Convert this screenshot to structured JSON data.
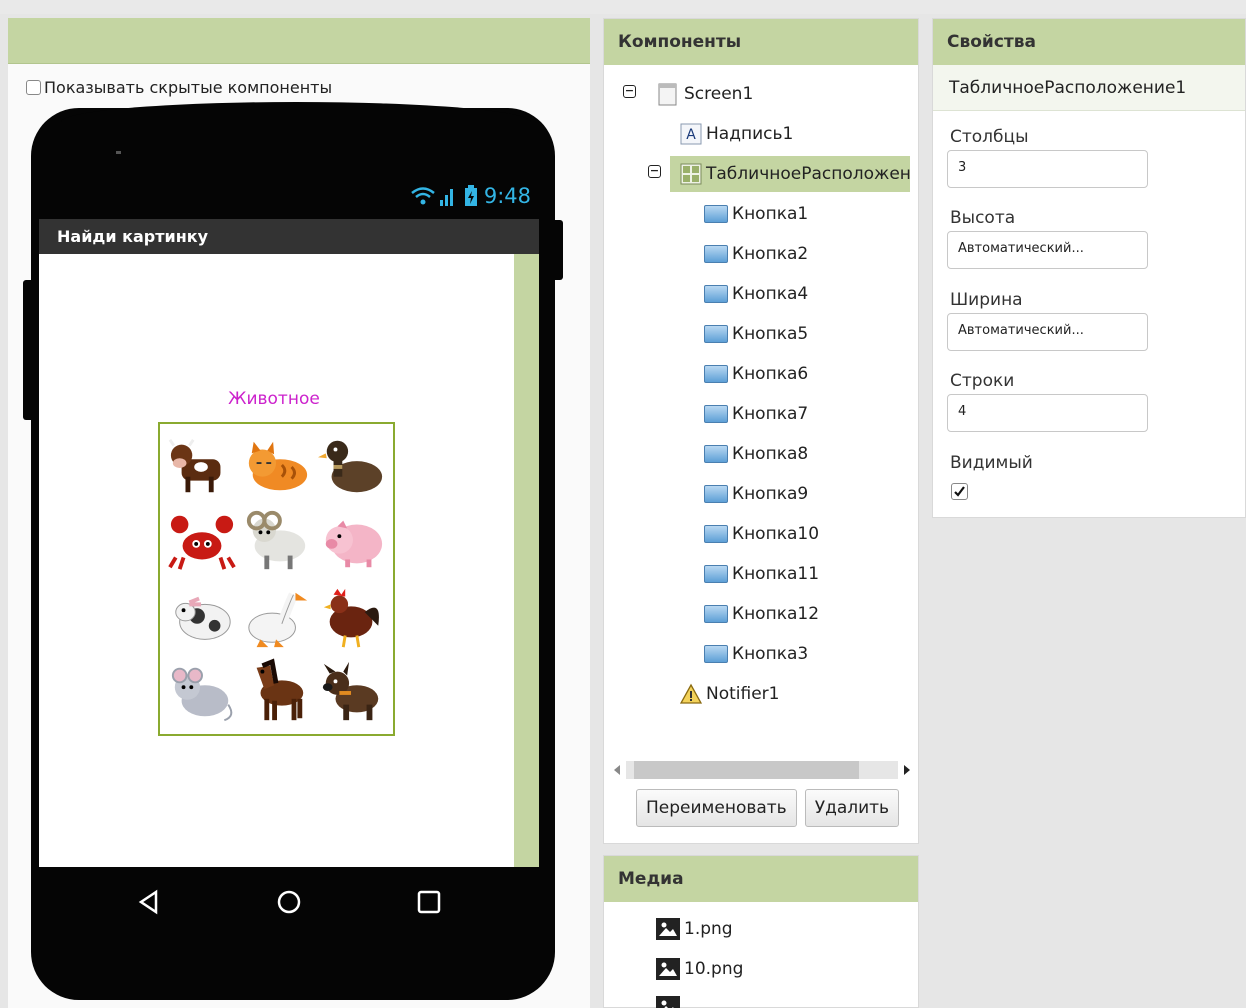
{
  "viewer": {
    "show_hidden_label": "Показывать скрытые компоненты",
    "status_time": "9:48",
    "app_title": "Найди картинку",
    "label_text": "Животное",
    "animals": [
      "cow",
      "cat",
      "duck",
      "crab",
      "ram",
      "pig",
      "goat",
      "goose",
      "rooster",
      "mouse",
      "horse",
      "dog"
    ]
  },
  "components": {
    "title": "Компоненты",
    "tree": [
      {
        "label": "Screen1",
        "icon": "screen-icon",
        "toggle": "⊟"
      },
      {
        "label": "Надпись1",
        "icon": "label-icon"
      },
      {
        "label": "ТабличноеРасположение1",
        "icon": "table-arrangement-icon",
        "toggle": "⊟",
        "selected": true
      },
      {
        "label": "Кнопка1",
        "icon": "button-icon"
      },
      {
        "label": "Кнопка2",
        "icon": "button-icon"
      },
      {
        "label": "Кнопка4",
        "icon": "button-icon"
      },
      {
        "label": "Кнопка5",
        "icon": "button-icon"
      },
      {
        "label": "Кнопка6",
        "icon": "button-icon"
      },
      {
        "label": "Кнопка7",
        "icon": "button-icon"
      },
      {
        "label": "Кнопка8",
        "icon": "button-icon"
      },
      {
        "label": "Кнопка9",
        "icon": "button-icon"
      },
      {
        "label": "Кнопка10",
        "icon": "button-icon"
      },
      {
        "label": "Кнопка11",
        "icon": "button-icon"
      },
      {
        "label": "Кнопка12",
        "icon": "button-icon"
      },
      {
        "label": "Кнопка3",
        "icon": "button-icon"
      },
      {
        "label": "Notifier1",
        "icon": "notifier-icon"
      }
    ],
    "rename_label": "Переименовать",
    "delete_label": "Удалить"
  },
  "media": {
    "title": "Медиа",
    "files": [
      "1.png",
      "10.png"
    ]
  },
  "properties": {
    "title": "Свойства",
    "component_name": "ТабличноеРасположение1",
    "columns_label": "Столбцы",
    "columns_value": "3",
    "height_label": "Высота",
    "height_value": "Автоматический...",
    "width_label": "Ширина",
    "width_value": "Автоматический...",
    "rows_label": "Строки",
    "rows_value": "4",
    "visible_label": "Видимый",
    "visible_checked": true
  }
}
